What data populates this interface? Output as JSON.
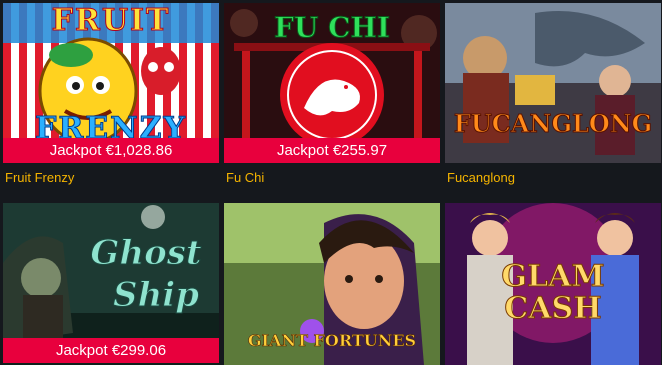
{
  "games": [
    {
      "title": "Fruit Frenzy",
      "jackpot": "Jackpot €1,028.86",
      "logo_top": "FRUIT",
      "logo_bottom": "FRENZY"
    },
    {
      "title": "Fu Chi",
      "jackpot": "Jackpot €255.97",
      "logo": "FU CHI"
    },
    {
      "title": "Fucanglong",
      "logo": "FUCANGLONG"
    },
    {
      "jackpot": "Jackpot €299.06",
      "logo_top": "Ghost",
      "logo_bottom": "Ship"
    },
    {
      "logo": "GIANT FORTUNES"
    },
    {
      "logo_top": "GLAM",
      "logo_bottom": "CASH"
    }
  ],
  "colors": {
    "background": "#15181d",
    "jackpot_bar": "#e8003d",
    "caption": "#f5b400"
  }
}
